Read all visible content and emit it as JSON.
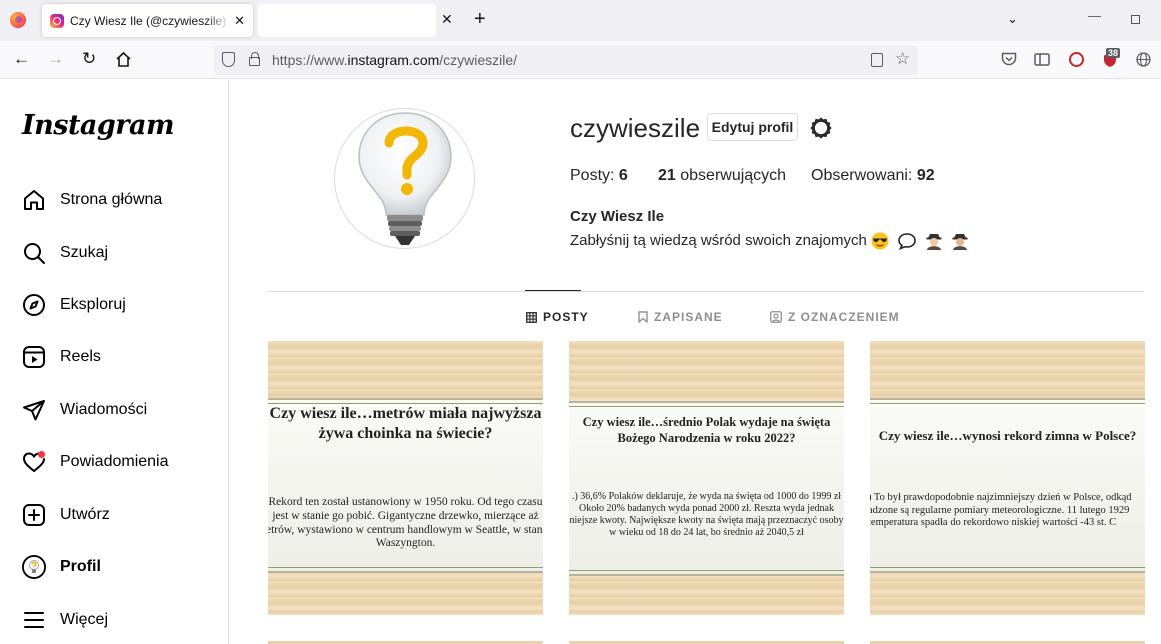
{
  "browser": {
    "tab_title": "Czy Wiesz Ile (@czywieszile) • Zdjęcia",
    "url_prefix": "https://www.",
    "url_host": "instagram.com",
    "url_path": "/czywieszile/",
    "extension_badge": "38"
  },
  "sidebar": {
    "logo": "Instagram",
    "items": [
      {
        "label": "Strona główna",
        "icon": "home-icon"
      },
      {
        "label": "Szukaj",
        "icon": "search-icon"
      },
      {
        "label": "Eksploruj",
        "icon": "compass-icon"
      },
      {
        "label": "Reels",
        "icon": "reels-icon"
      },
      {
        "label": "Wiadomości",
        "icon": "send-icon"
      },
      {
        "label": "Powiadomienia",
        "icon": "heart-icon"
      },
      {
        "label": "Utwórz",
        "icon": "plus-square-icon"
      },
      {
        "label": "Profil",
        "icon": "profile-avatar-icon"
      },
      {
        "label": "Więcej",
        "icon": "menu-icon"
      }
    ]
  },
  "profile": {
    "username": "czywieszile",
    "edit_button": "Edytuj profil",
    "posts_label": "Posty: ",
    "posts_count": "6",
    "followers_count": "21",
    "followers_label": " obserwujących",
    "following_label": "Obserwowani: ",
    "following_count": "92",
    "full_name": "Czy Wiesz Ile",
    "bio": "Zabłyśnij tą wiedzą wśród swoich znajomych"
  },
  "tabs": [
    {
      "label": "POSTY",
      "icon": "grid-icon",
      "active": true
    },
    {
      "label": "ZAPISANE",
      "icon": "bookmark-icon",
      "active": false
    },
    {
      "label": "Z OZNACZENIEM",
      "icon": "tagged-icon",
      "active": false
    }
  ],
  "posts": [
    {
      "question_lines": [
        "Czy wiesz ile…metrów miała najwyższa",
        "żywa choinka na świecie?"
      ],
      "answer_lines": [
        "Rekord ten został ustanowiony w 1950 roku. Od tego czasu",
        "jest w stanie go pobić. Gigantyczne drzewko, mierzące aż",
        "etrów, wystawiono w centrum handlowym w Seattle, w stanie",
        "Waszyngton."
      ]
    },
    {
      "question_lines": [
        "Czy wiesz ile…średnio Polak wydaje na święta",
        "Bożego Narodzenia w roku 2022?"
      ],
      "answer_lines": [
        ".) 36,6% Polaków deklaruje, że wyda na święta od 1000 do 1999 zł",
        "Około 20% badanych wyda ponad 2000 zł. Reszta wyda jednak",
        "niejsze kwoty. Największe kwoty na święta mają przeznaczyć osoby",
        "w wieku od 18 do 24 lat, bo średnio aż 2040,5 zł"
      ]
    },
    {
      "question_lines": [
        "Czy wiesz ile…wynosi rekord zimna w Polsce?"
      ],
      "answer_lines": [
        ") To był prawdopodobnie najzimniejszy dzień w Polsce, odkąd",
        "adzone są regularne pomiary meteorologiczne. 11 lutego 1929",
        "temperatura spadła do rekordowo niskiej wartości -43 st. C"
      ]
    }
  ]
}
